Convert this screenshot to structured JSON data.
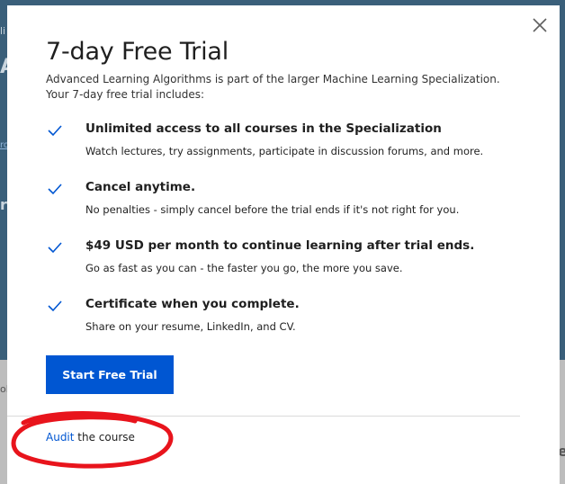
{
  "background": {
    "fragments": [
      "li",
      "A",
      "ro",
      "r",
      "ol",
      "e"
    ]
  },
  "modal": {
    "title": "7-day Free Trial",
    "intro": "Advanced Learning Algorithms is part of the larger Machine Learning Specialization. Your 7-day free trial includes:",
    "close_icon": "close-icon",
    "check_icon": "checkmark-icon",
    "benefits": [
      {
        "title": "Unlimited access to all courses in the Specialization",
        "desc": "Watch lectures, try assignments, participate in discussion forums, and more."
      },
      {
        "title": "Cancel anytime.",
        "desc": "No penalties - simply cancel before the trial ends if it's not right for you."
      },
      {
        "title": "$49 USD per month to continue learning after trial ends.",
        "desc": "Go as fast as you can - the faster you go, the more you save."
      },
      {
        "title": "Certificate when you complete.",
        "desc": "Share on your resume, LinkedIn, and CV."
      }
    ],
    "cta_label": "Start Free Trial",
    "audit_link": "Audit",
    "audit_suffix": " the course"
  },
  "colors": {
    "accent": "#0056d2",
    "annotation": "#e8141c"
  }
}
